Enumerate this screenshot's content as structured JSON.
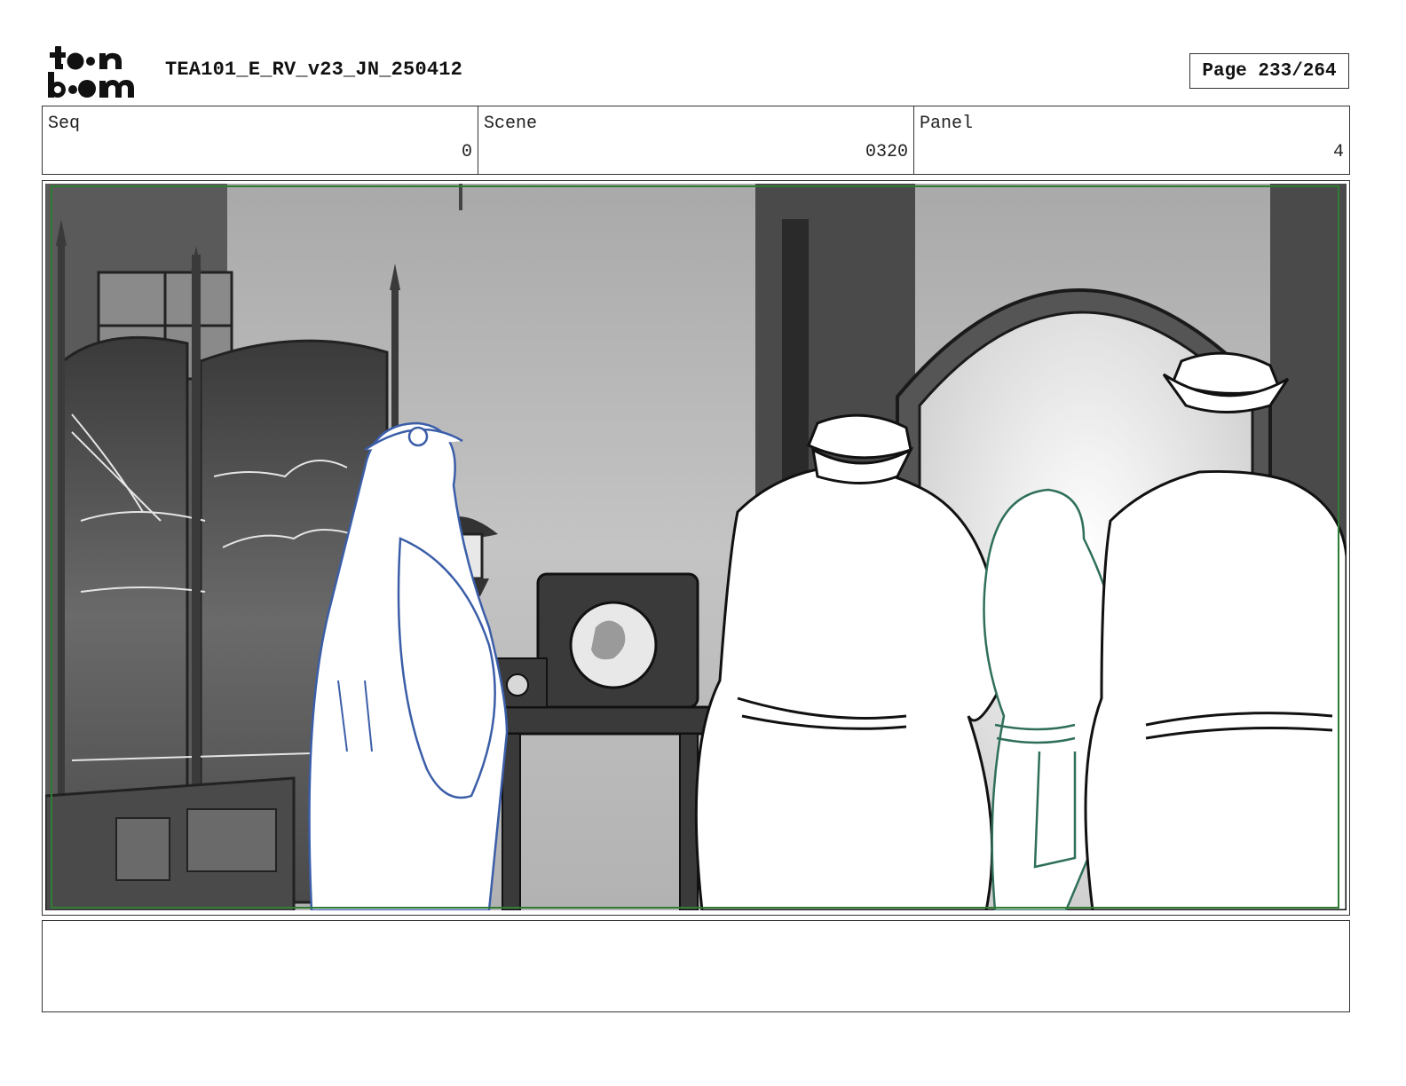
{
  "header": {
    "logo_top": "toon",
    "logo_bottom": "boom",
    "document_title": "TEA101_E_RV_v23_JN_250412",
    "page_label": "Page 233/264"
  },
  "info": {
    "seq_label": "Seq",
    "seq_value": "0",
    "scene_label": "Scene",
    "scene_value": "0320",
    "panel_label": "Panel",
    "panel_value": "4"
  },
  "panel_image": {
    "description_icon": "storyboard-panel-illustration",
    "safe_frame_color": "#2e7d32"
  },
  "notes": {
    "text": ""
  }
}
